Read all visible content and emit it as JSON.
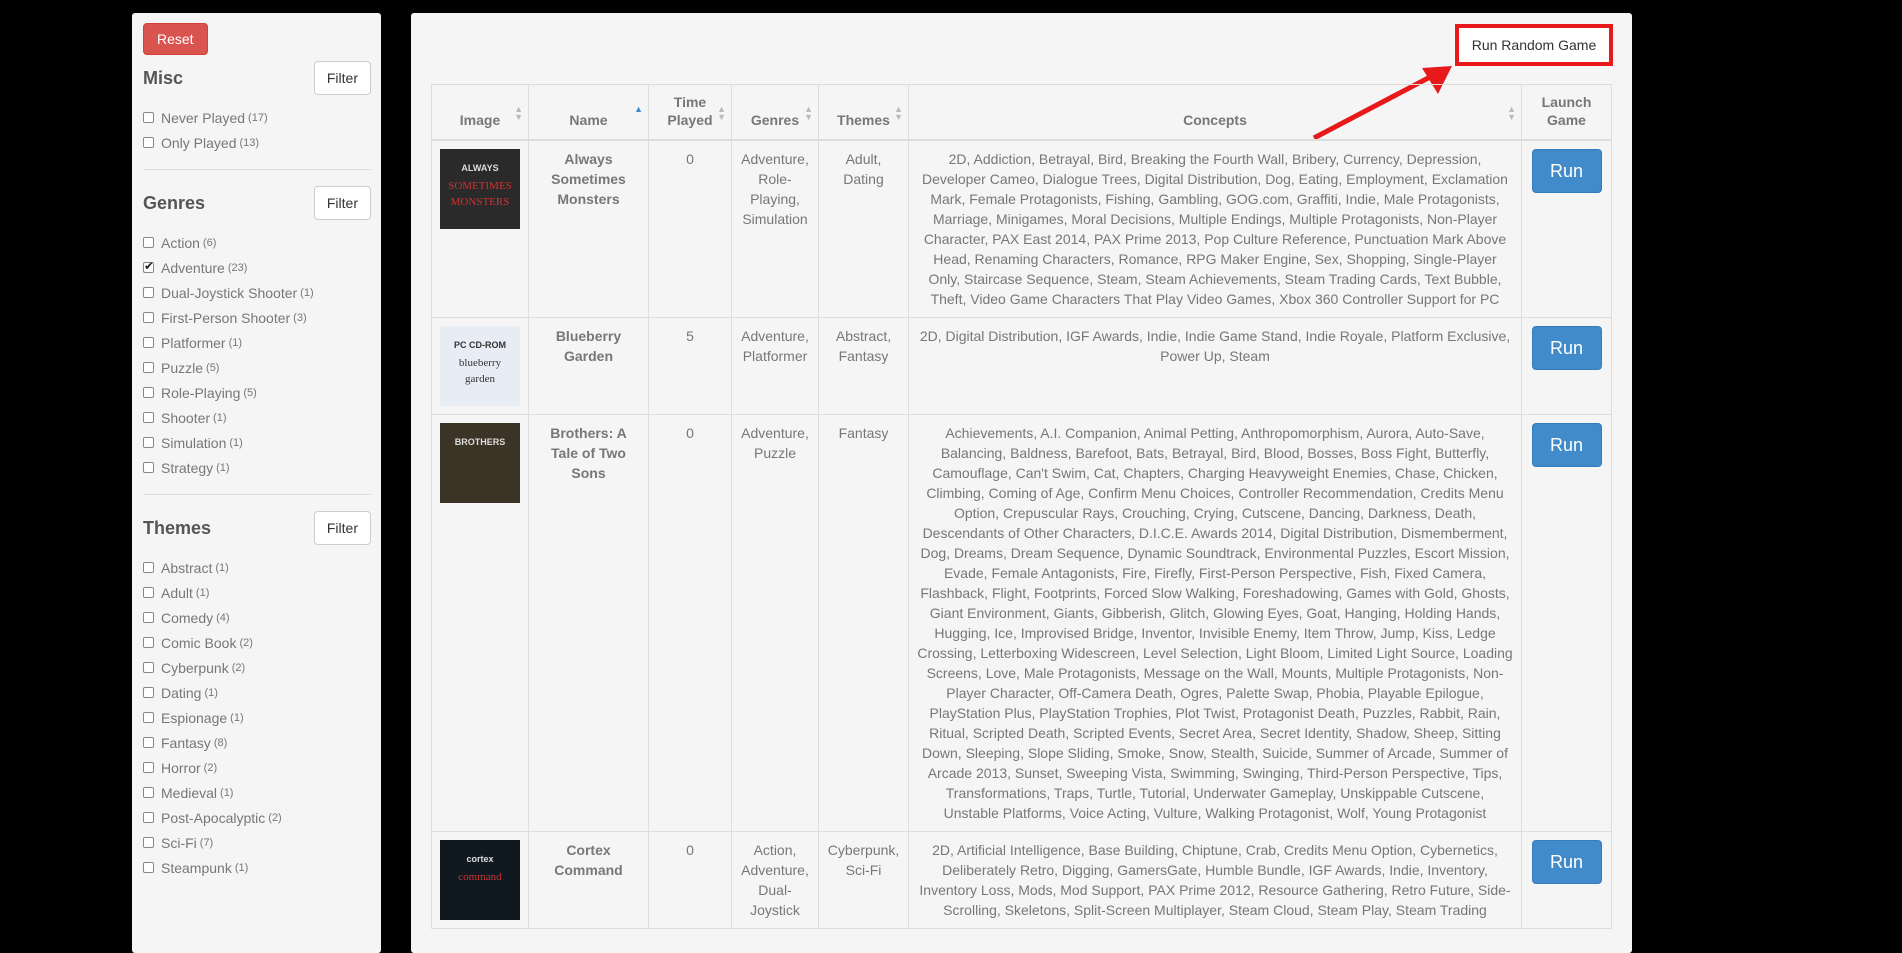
{
  "sidebar": {
    "reset_label": "Reset",
    "sections": [
      {
        "title": "Misc",
        "filter_label": "Filter",
        "items": [
          {
            "label": "Never Played",
            "count": "(17)",
            "checked": false
          },
          {
            "label": "Only Played",
            "count": "(13)",
            "checked": false
          }
        ]
      },
      {
        "title": "Genres",
        "filter_label": "Filter",
        "items": [
          {
            "label": "Action",
            "count": "(6)",
            "checked": false
          },
          {
            "label": "Adventure",
            "count": "(23)",
            "checked": true
          },
          {
            "label": "Dual-Joystick Shooter",
            "count": "(1)",
            "checked": false
          },
          {
            "label": "First-Person Shooter",
            "count": "(3)",
            "checked": false
          },
          {
            "label": "Platformer",
            "count": "(1)",
            "checked": false
          },
          {
            "label": "Puzzle",
            "count": "(5)",
            "checked": false
          },
          {
            "label": "Role-Playing",
            "count": "(5)",
            "checked": false
          },
          {
            "label": "Shooter",
            "count": "(1)",
            "checked": false
          },
          {
            "label": "Simulation",
            "count": "(1)",
            "checked": false
          },
          {
            "label": "Strategy",
            "count": "(1)",
            "checked": false
          }
        ]
      },
      {
        "title": "Themes",
        "filter_label": "Filter",
        "items": [
          {
            "label": "Abstract",
            "count": "(1)",
            "checked": false
          },
          {
            "label": "Adult",
            "count": "(1)",
            "checked": false
          },
          {
            "label": "Comedy",
            "count": "(4)",
            "checked": false
          },
          {
            "label": "Comic Book",
            "count": "(2)",
            "checked": false
          },
          {
            "label": "Cyberpunk",
            "count": "(2)",
            "checked": false
          },
          {
            "label": "Dating",
            "count": "(1)",
            "checked": false
          },
          {
            "label": "Espionage",
            "count": "(1)",
            "checked": false
          },
          {
            "label": "Fantasy",
            "count": "(8)",
            "checked": false
          },
          {
            "label": "Horror",
            "count": "(2)",
            "checked": false
          },
          {
            "label": "Medieval",
            "count": "(1)",
            "checked": false
          },
          {
            "label": "Post-Apocalyptic",
            "count": "(2)",
            "checked": false
          },
          {
            "label": "Sci-Fi",
            "count": "(7)",
            "checked": false
          },
          {
            "label": "Steampunk",
            "count": "(1)",
            "checked": false
          }
        ]
      }
    ]
  },
  "toolbar": {
    "random_label": "Run Random Game"
  },
  "table": {
    "headers": {
      "image": "Image",
      "name": "Name",
      "time": "Time Played",
      "genres": "Genres",
      "themes": "Themes",
      "concepts": "Concepts",
      "launch": "Launch Game"
    },
    "run_label": "Run",
    "rows": [
      {
        "name": "Always Sometimes Monsters",
        "time": "0",
        "genres": "Adventure, Role-Playing, Simulation",
        "themes": "Adult, Dating",
        "concepts": "2D, Addiction, Betrayal, Bird, Breaking the Fourth Wall, Bribery, Currency, Depression, Developer Cameo, Dialogue Trees, Digital Distribution, Dog, Eating, Employment, Exclamation Mark, Female Protagonists, Fishing, Gambling, GOG.com, Graffiti, Indie, Male Protagonists, Marriage, Minigames, Moral Decisions, Multiple Endings, Multiple Protagonists, Non-Player Character, PAX East 2014, PAX Prime 2013, Pop Culture Reference, Punctuation Mark Above Head, Renaming Characters, Romance, RPG Maker Engine, Sex, Shopping, Single-Player Only, Staircase Sequence, Steam, Steam Achievements, Steam Trading Cards, Text Bubble, Theft, Video Game Characters That Play Video Games, Xbox 360 Controller Support for PC",
        "thumb": {
          "bg": "#2a2a2a",
          "text1": "ALWAYS",
          "text2": "SOMETIMES",
          "text3": "MONSTERS"
        }
      },
      {
        "name": "Blueberry Garden",
        "time": "5",
        "genres": "Adventure, Platformer",
        "themes": "Abstract, Fantasy",
        "concepts": "2D, Digital Distribution, IGF Awards, Indie, Indie Game Stand, Indie Royale, Platform Exclusive, Power Up, Steam",
        "thumb": {
          "bg": "#e8ecf5",
          "text1": "PC CD-ROM",
          "text2": "blueberry",
          "text3": "garden"
        }
      },
      {
        "name": "Brothers: A Tale of Two Sons",
        "time": "0",
        "genres": "Adventure, Puzzle",
        "themes": "Fantasy",
        "concepts": "Achievements, A.I. Companion, Animal Petting, Anthropomorphism, Aurora, Auto-Save, Balancing, Baldness, Barefoot, Bats, Betrayal, Bird, Blood, Bosses, Boss Fight, Butterfly, Camouflage, Can't Swim, Cat, Chapters, Charging Heavyweight Enemies, Chase, Chicken, Climbing, Coming of Age, Confirm Menu Choices, Controller Recommendation, Credits Menu Option, Crepuscular Rays, Crouching, Crying, Cutscene, Dancing, Darkness, Death, Descendants of Other Characters, D.I.C.E. Awards 2014, Digital Distribution, Dismemberment, Dog, Dreams, Dream Sequence, Dynamic Soundtrack, Environmental Puzzles, Escort Mission, Evade, Female Antagonists, Fire, Firefly, First-Person Perspective, Fish, Fixed Camera, Flashback, Flight, Footprints, Forced Slow Walking, Foreshadowing, Games with Gold, Ghosts, Giant Environment, Giants, Gibberish, Glitch, Glowing Eyes, Goat, Hanging, Holding Hands, Hugging, Ice, Improvised Bridge, Inventor, Invisible Enemy, Item Throw, Jump, Kiss, Ledge Crossing, Letterboxing Widescreen, Level Selection, Light Bloom, Limited Light Source, Loading Screens, Love, Male Protagonists, Message on the Wall, Mounts, Multiple Protagonists, Non-Player Character, Off-Camera Death, Ogres, Palette Swap, Phobia, Playable Epilogue, PlayStation Plus, PlayStation Trophies, Plot Twist, Protagonist Death, Puzzles, Rabbit, Rain, Ritual, Scripted Death, Scripted Events, Secret Area, Secret Identity, Shadow, Sheep, Sitting Down, Sleeping, Slope Sliding, Smoke, Snow, Stealth, Suicide, Summer of Arcade, Summer of Arcade 2013, Sunset, Sweeping Vista, Swimming, Swinging, Third-Person Perspective, Tips, Transformations, Traps, Turtle, Tutorial, Underwater Gameplay, Unskippable Cutscene, Unstable Platforms, Voice Acting, Vulture, Walking Protagonist, Wolf, Young Protagonist",
        "thumb": {
          "bg": "#3a3326",
          "text1": "BROTHERS",
          "text2": "",
          "text3": ""
        }
      },
      {
        "name": "Cortex Command",
        "time": "0",
        "genres": "Action, Adventure, Dual-Joystick",
        "themes": "Cyberpunk, Sci-Fi",
        "concepts": "2D, Artificial Intelligence, Base Building, Chiptune, Crab, Credits Menu Option, Cybernetics, Deliberately Retro, Digging, GamersGate, Humble Bundle, IGF Awards, Indie, Inventory, Inventory Loss, Mods, Mod Support, PAX Prime 2012, Resource Gathering, Retro Future, Side-Scrolling, Skeletons, Split-Screen Multiplayer, Steam Cloud, Steam Play, Steam Trading",
        "thumb": {
          "bg": "#101820",
          "text1": "cortex",
          "text2": "command",
          "text3": ""
        }
      }
    ]
  }
}
